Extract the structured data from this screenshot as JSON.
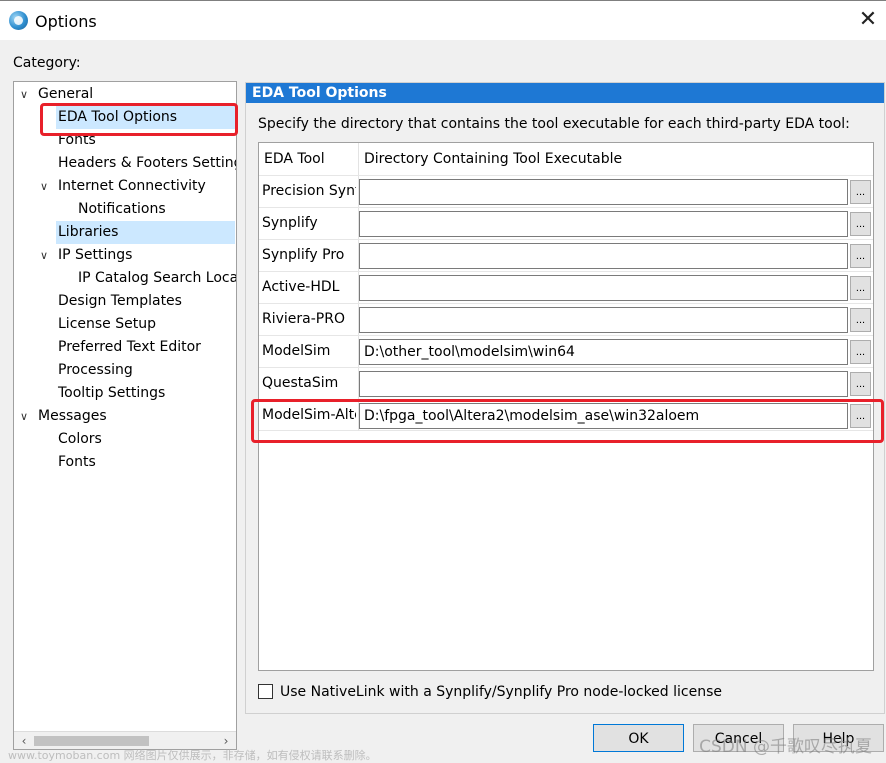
{
  "window": {
    "title": "Options",
    "close_glyph": "✕"
  },
  "category_label": "Category:",
  "tree": {
    "items": [
      {
        "label": "General",
        "toggle": "∨"
      },
      {
        "label": "EDA Tool Options"
      },
      {
        "label": "Fonts"
      },
      {
        "label": "Headers & Footers Settings"
      },
      {
        "label": "Internet Connectivity",
        "toggle": "∨"
      },
      {
        "label": "Notifications"
      },
      {
        "label": "Libraries"
      },
      {
        "label": "IP Settings",
        "toggle": "∨"
      },
      {
        "label": "IP Catalog Search Locations"
      },
      {
        "label": "Design Templates"
      },
      {
        "label": "License Setup"
      },
      {
        "label": "Preferred Text Editor"
      },
      {
        "label": "Processing"
      },
      {
        "label": "Tooltip Settings"
      },
      {
        "label": "Messages",
        "toggle": "∨"
      },
      {
        "label": "Colors"
      },
      {
        "label": "Fonts"
      }
    ],
    "scroll_left": "‹",
    "scroll_right": "›"
  },
  "panel": {
    "header": "EDA Tool Options",
    "description": "Specify the directory that contains the tool executable for each third-party EDA tool:",
    "table": {
      "col_tool": "EDA Tool",
      "col_dir": "Directory Containing Tool Executable",
      "browse_label": "...",
      "rows": [
        {
          "name": "Precision Synthesis",
          "path": ""
        },
        {
          "name": "Synplify",
          "path": ""
        },
        {
          "name": "Synplify Pro",
          "path": ""
        },
        {
          "name": "Active-HDL",
          "path": ""
        },
        {
          "name": "Riviera-PRO",
          "path": ""
        },
        {
          "name": "ModelSim",
          "path": "D:\\other_tool\\modelsim\\win64"
        },
        {
          "name": "QuestaSim",
          "path": ""
        },
        {
          "name": "ModelSim-Altera",
          "path": "D:\\fpga_tool\\Altera2\\modelsim_ase\\win32aloem"
        }
      ]
    },
    "nativelink_label": "Use NativeLink with a Synplify/Synplify Pro node-locked license"
  },
  "buttons": {
    "ok": "OK",
    "cancel": "Cancel",
    "help": "Help"
  },
  "watermarks": {
    "left": "www.toymoban.com 网络图片仅供展示，非存储，如有侵权请联系删除。",
    "right": "CSDN @千歌叹尽执夏"
  },
  "colors": {
    "header_blue": "#1e78d4",
    "selection": "#cce8ff",
    "highlight_red": "#e8202a"
  }
}
